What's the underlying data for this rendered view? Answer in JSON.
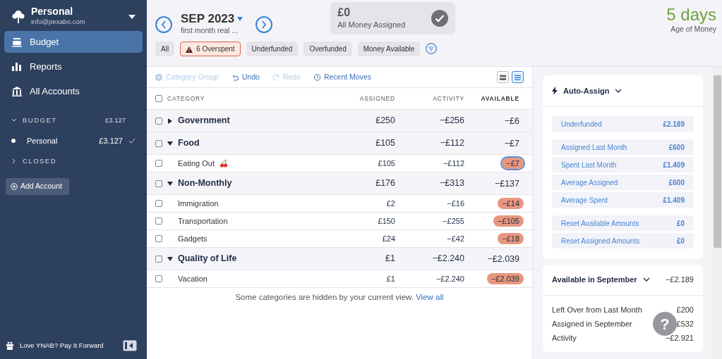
{
  "sidebar": {
    "budget_name": "Personal",
    "email": "info@pexabo.com",
    "nav": [
      {
        "label": "Budget",
        "kind": "budget",
        "selected": true
      },
      {
        "label": "Reports",
        "kind": "reports",
        "selected": false
      },
      {
        "label": "All Accounts",
        "kind": "accounts",
        "selected": false
      }
    ],
    "sections": [
      {
        "label": "BUDGET",
        "expanded": true,
        "amount": "£3.127",
        "accounts": [
          {
            "name": "Personal",
            "amount": "£3.127",
            "reconciled": true
          }
        ]
      },
      {
        "label": "CLOSED",
        "expanded": false
      }
    ],
    "add_account": "Add Account",
    "footer": "Love YNAB? Pay It Forward"
  },
  "header": {
    "month": "SEP 2023",
    "month_note": "first month real ...",
    "ready": {
      "amount": "£0",
      "label": "All Money Assigned"
    },
    "age": {
      "value": "5 days",
      "label": "Age of Money"
    }
  },
  "filters": [
    {
      "label": "All",
      "selected": false,
      "kind": "plain"
    },
    {
      "label": "6 Overspent",
      "selected": true,
      "kind": "warning"
    },
    {
      "label": "Underfunded",
      "selected": false,
      "kind": "plain"
    },
    {
      "label": "Overfunded",
      "selected": false,
      "kind": "plain"
    },
    {
      "label": "Money Available",
      "selected": false,
      "kind": "plain"
    }
  ],
  "toolbar": [
    {
      "label": "Category Group",
      "kind": "add",
      "disabled": true
    },
    {
      "label": "Undo",
      "kind": "undo",
      "disabled": false
    },
    {
      "label": "Redo",
      "kind": "redo",
      "disabled": true
    },
    {
      "label": "Recent Moves",
      "kind": "history",
      "disabled": false
    }
  ],
  "view_toggle": [
    {
      "kind": "expanded",
      "selected": false
    },
    {
      "kind": "compact",
      "selected": true
    }
  ],
  "table": {
    "columns": [
      "CATEGORY",
      "ASSIGNED",
      "ACTIVITY",
      "AVAILABLE"
    ],
    "select_all": {
      "checked": false
    },
    "groups": [
      {
        "name": "Government",
        "expanded": false,
        "assigned": "£250",
        "activity": "−£256",
        "available": "−£6",
        "checked": false
      },
      {
        "name": "Food",
        "expanded": true,
        "checked": false,
        "assigned": "£105",
        "activity": "−£112",
        "available": "−£7",
        "categories": [
          {
            "name": "Eating Out",
            "checked": false,
            "tagged": true,
            "assigned": "£105",
            "activity": "−£112",
            "available": "−£7",
            "overspent": true,
            "focused": true
          }
        ]
      },
      {
        "name": "Non-Monthly",
        "expanded": true,
        "checked": false,
        "assigned": "£176",
        "activity": "−£313",
        "available": "−£137",
        "categories": [
          {
            "name": "Immigration",
            "checked": false,
            "tagged": false,
            "assigned": "£2",
            "activity": "−£16",
            "available": "−£14",
            "overspent": true,
            "focused": false
          },
          {
            "name": "Transportation",
            "checked": false,
            "tagged": false,
            "assigned": "£150",
            "activity": "−£255",
            "available": "−£105",
            "overspent": true,
            "focused": false
          },
          {
            "name": "Gadgets",
            "checked": false,
            "tagged": false,
            "assigned": "£24",
            "activity": "−£42",
            "available": "−£18",
            "overspent": true,
            "focused": false
          }
        ]
      },
      {
        "name": "Quality of Life",
        "expanded": true,
        "checked": false,
        "assigned": "£1",
        "activity": "−£2.240",
        "available": "−£2.039",
        "categories": [
          {
            "name": "Vacation",
            "checked": false,
            "tagged": false,
            "assigned": "£1",
            "activity": "−£2.240",
            "available": "−£2.039",
            "overspent": true,
            "focused": false
          }
        ]
      }
    ],
    "hidden_note": {
      "text": "Some categories are hidden by your current view.",
      "link": "View all"
    }
  },
  "auto_assign": {
    "title": "Auto-Assign",
    "expanded": true,
    "groups": [
      [
        {
          "label": "Underfunded",
          "amount": "£2.189"
        }
      ],
      [
        {
          "label": "Assigned Last Month",
          "amount": "£600"
        },
        {
          "label": "Spent Last Month",
          "amount": "£1.409"
        },
        {
          "label": "Average Assigned",
          "amount": "£600"
        },
        {
          "label": "Average Spent",
          "amount": "£1.409"
        }
      ],
      [
        {
          "label": "Reset Available Amounts",
          "amount": "£0"
        },
        {
          "label": "Reset Assigned Amounts",
          "amount": "£0"
        }
      ]
    ]
  },
  "available_card": {
    "title": "Available in September",
    "amount": "−£2.189",
    "rows": [
      {
        "label": "Left Over from Last Month",
        "amount": "£200"
      },
      {
        "label": "Assigned in September",
        "amount": "£532"
      },
      {
        "label": "Activity",
        "amount": "−£2.921"
      }
    ]
  },
  "help": "?"
}
